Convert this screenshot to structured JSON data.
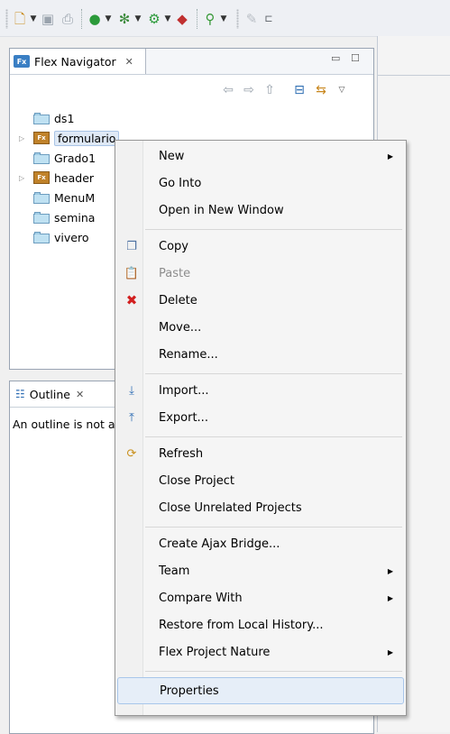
{
  "toolbar": {
    "icons": [
      "new-icon",
      "save-icon",
      "print-icon",
      "run-icon",
      "debug-icon",
      "external-tools-icon",
      "deploy-icon",
      "search-icon",
      "pen-icon",
      "layout-icon"
    ]
  },
  "navigator": {
    "tab_label": "Flex Navigator",
    "close_glyph": "✕",
    "min_glyph": "▭",
    "max_glyph": "☐",
    "tree": [
      {
        "label": "ds1",
        "kind": "folder",
        "expandable": false
      },
      {
        "label": "formulario",
        "kind": "fx",
        "expandable": true,
        "selected": true
      },
      {
        "label": "Grado1",
        "kind": "folder",
        "expandable": false
      },
      {
        "label": "header",
        "kind": "fx",
        "expandable": true
      },
      {
        "label": "MenuM",
        "kind": "folder",
        "expandable": false
      },
      {
        "label": "semina",
        "kind": "folder",
        "expandable": false
      },
      {
        "label": "vivero",
        "kind": "folder",
        "expandable": false
      }
    ]
  },
  "outline": {
    "tab_label": "Outline",
    "message": "An outline is not available."
  },
  "menu": {
    "items": [
      {
        "label": "New",
        "submenu": true
      },
      {
        "label": "Go Into"
      },
      {
        "label": "Open in New Window"
      },
      {
        "sep": true
      },
      {
        "label": "Copy",
        "icon": "copy-icon"
      },
      {
        "label": "Paste",
        "icon": "paste-icon",
        "disabled": true
      },
      {
        "label": "Delete",
        "icon": "delete-icon"
      },
      {
        "label": "Move..."
      },
      {
        "label": "Rename..."
      },
      {
        "sep": true
      },
      {
        "label": "Import...",
        "icon": "import-icon"
      },
      {
        "label": "Export...",
        "icon": "export-icon"
      },
      {
        "sep": true
      },
      {
        "label": "Refresh",
        "icon": "refresh-icon"
      },
      {
        "label": "Close Project"
      },
      {
        "label": "Close Unrelated Projects"
      },
      {
        "sep": true
      },
      {
        "label": "Create Ajax Bridge..."
      },
      {
        "label": "Team",
        "submenu": true
      },
      {
        "label": "Compare With",
        "submenu": true
      },
      {
        "label": "Restore from Local History..."
      },
      {
        "label": "Flex Project Nature",
        "submenu": true
      },
      {
        "sep": true
      },
      {
        "label": "Properties",
        "hover": true
      }
    ]
  }
}
